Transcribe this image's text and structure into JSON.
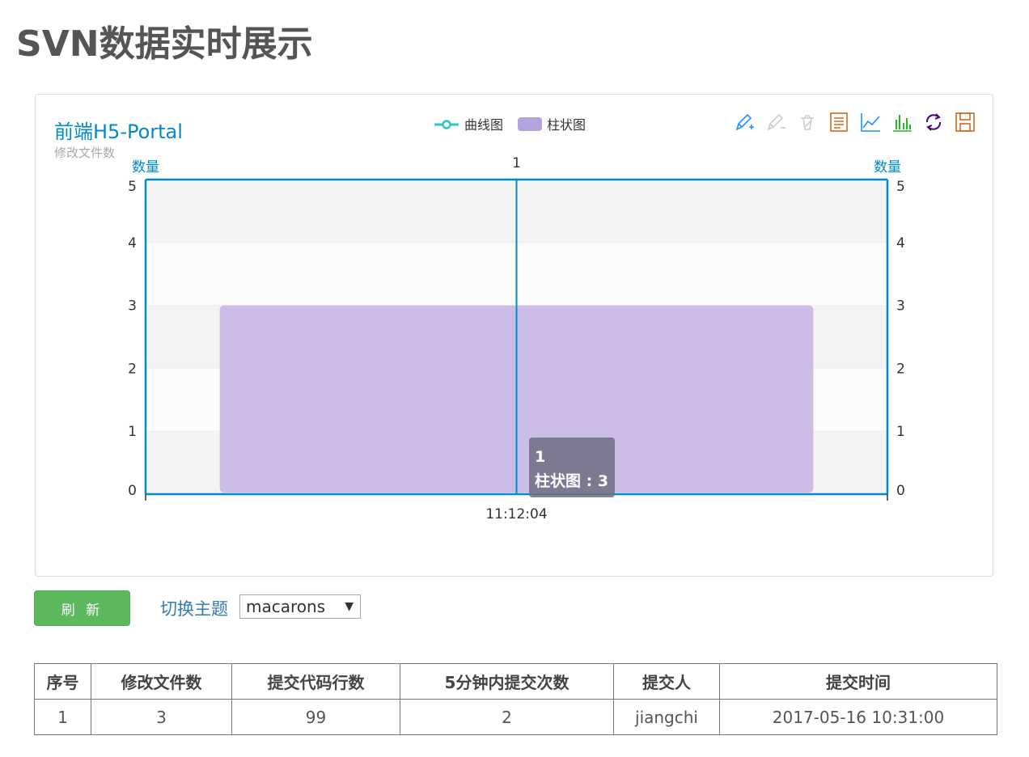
{
  "page": {
    "title": "SVN数据实时展示"
  },
  "chart": {
    "title": "前端H5-Portal",
    "subtitle": "修改文件数",
    "legend": [
      {
        "name": "曲线图",
        "type": "line",
        "color": "#2ec7c9"
      },
      {
        "name": "柱状图",
        "type": "bar",
        "color": "#b6a2de"
      }
    ],
    "toolbox": [
      {
        "name": "mark-pen-icon",
        "color": "#2ec7c9"
      },
      {
        "name": "mark-undo-icon",
        "color": "#cccccc"
      },
      {
        "name": "mark-clear-icon",
        "color": "#cccccc"
      },
      {
        "name": "data-view-icon",
        "color": "#d87a80"
      },
      {
        "name": "line-chart-icon",
        "color": "#1e90ff"
      },
      {
        "name": "bar-chart-icon",
        "color": "#22bb22"
      },
      {
        "name": "restore-icon",
        "color": "#4b0082"
      },
      {
        "name": "save-image-icon",
        "color": "#d2691e"
      }
    ],
    "tooltip": {
      "title": "1",
      "body": "柱状图 : 3"
    }
  },
  "chart_data": {
    "type": "bar",
    "categories": [
      "11:12:04"
    ],
    "top_categories": [
      "1"
    ],
    "series": [
      {
        "name": "柱状图",
        "type": "bar",
        "values": [
          3
        ]
      },
      {
        "name": "曲线图",
        "type": "line",
        "values": []
      }
    ],
    "ylabel_left": "数量",
    "ylabel_right": "数量",
    "ylim": [
      0,
      5
    ],
    "yticks": [
      0,
      1,
      2,
      3,
      4,
      5
    ],
    "grid": true,
    "legend_position": "top-center",
    "colors": {
      "axis": "#008acd",
      "bar": "#b6a2de",
      "bar_fill": "#cbbce8"
    }
  },
  "controls": {
    "refresh_label": "刷 新",
    "theme_label": "切换主题",
    "theme_value": "macarons",
    "theme_arrow": "▼"
  },
  "table": {
    "headers": [
      "序号",
      "修改文件数",
      "提交代码行数",
      "5分钟内提交次数",
      "提交人",
      "提交时间"
    ],
    "rows": [
      [
        "1",
        "3",
        "99",
        "2",
        "jiangchi",
        "2017-05-16 10:31:00"
      ]
    ]
  }
}
